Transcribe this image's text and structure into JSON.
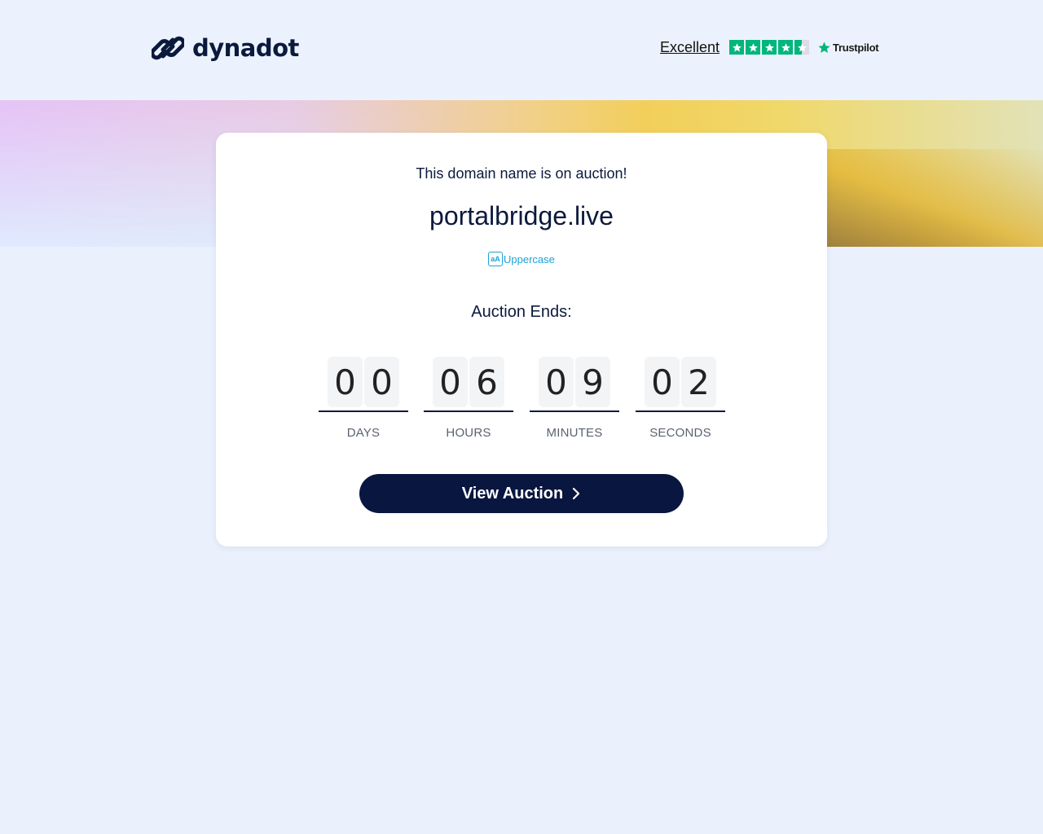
{
  "header": {
    "logo_text": "dynadot",
    "logo_icon": "chain-link-icon",
    "trustpilot": {
      "rating_label": "Excellent",
      "stars": 4.5,
      "brand": "Trustpilot",
      "star_color": "#00b67a"
    }
  },
  "card": {
    "notice": "This domain name is on auction!",
    "domain": "portalbridge.live",
    "uppercase_label": "Uppercase",
    "uppercase_icon_text": "aA",
    "auction_ends_label": "Auction Ends:",
    "countdown": [
      {
        "digits": [
          "0",
          "0"
        ],
        "label": "DAYS"
      },
      {
        "digits": [
          "0",
          "6"
        ],
        "label": "HOURS"
      },
      {
        "digits": [
          "0",
          "9"
        ],
        "label": "MINUTES"
      },
      {
        "digits": [
          "0",
          "2"
        ],
        "label": "SECONDS"
      }
    ],
    "cta_label": "View Auction"
  },
  "colors": {
    "navy": "#0b1a3c",
    "button": "#091640",
    "accent_link": "#1ba3d8"
  }
}
